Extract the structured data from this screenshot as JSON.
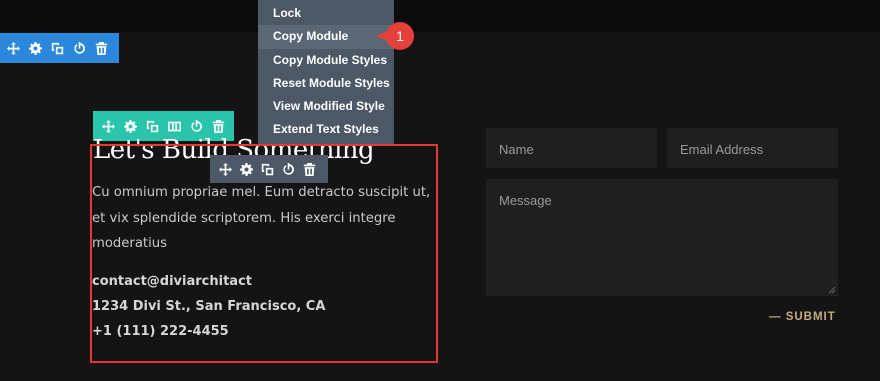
{
  "context_menu": {
    "items": [
      {
        "label": "Lock"
      },
      {
        "label": "Copy Module"
      },
      {
        "label": "Copy Module Styles"
      },
      {
        "label": "Reset Module Styles"
      },
      {
        "label": "View Modified Style"
      },
      {
        "label": "Extend Text Styles"
      }
    ],
    "highlighted": "Copy Module"
  },
  "callout": {
    "number": "1",
    "color": "#e5403a"
  },
  "toolbars": {
    "section": {
      "color": "#2b87da",
      "icons": [
        "move-icon",
        "gear-icon",
        "duplicate-icon",
        "power-icon",
        "trash-icon"
      ]
    },
    "row": {
      "color": "#29c4a9",
      "icons": [
        "move-icon",
        "gear-icon",
        "duplicate-icon",
        "columns-icon",
        "power-icon",
        "trash-icon"
      ]
    },
    "module": {
      "color": "#4c5866",
      "icons": [
        "move-icon",
        "gear-icon",
        "duplicate-icon",
        "power-icon",
        "trash-icon"
      ]
    }
  },
  "content": {
    "heading": "Let's Build Something",
    "body": "Cu omnium propriae mel. Eum detracto suscipit ut, et vix splendide scriptorem. His exerci integre moderatius",
    "email": "contact@diviarchitact",
    "address": "1234 Divi St., San Francisco, CA",
    "phone": "+1 (111) 222-4455"
  },
  "form": {
    "name_placeholder": "Name",
    "email_placeholder": "Email Address",
    "message_placeholder": "Message",
    "submit_label": "— SUBMIT"
  },
  "colors": {
    "selection_border": "#e53935",
    "accent": "#c8a97e"
  }
}
